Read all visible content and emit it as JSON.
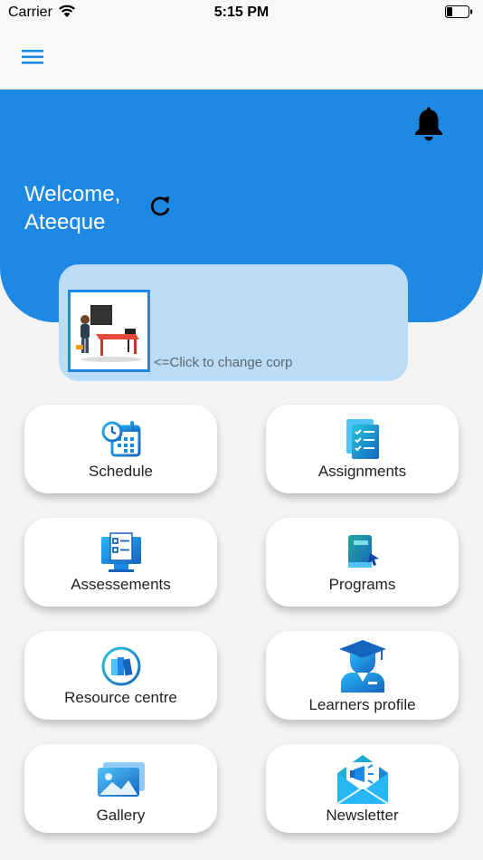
{
  "status_bar": {
    "carrier": "Carrier",
    "time": "5:15 PM"
  },
  "header": {
    "welcome_line1": "Welcome,",
    "welcome_line2": "Ateeque"
  },
  "corp": {
    "hint": "<=Click to change corp"
  },
  "tiles": [
    {
      "label": "Schedule",
      "icon": "schedule-icon"
    },
    {
      "label": "Assignments",
      "icon": "assignments-icon"
    },
    {
      "label": "Assessements",
      "icon": "assessments-icon"
    },
    {
      "label": "Programs",
      "icon": "programs-icon"
    },
    {
      "label": "Resource centre",
      "icon": "resource-centre-icon"
    },
    {
      "label": "Learners profile",
      "icon": "learners-profile-icon"
    },
    {
      "label": "Gallery",
      "icon": "gallery-icon"
    },
    {
      "label": "Newsletter",
      "icon": "newsletter-icon"
    }
  ],
  "colors": {
    "primary": "#1e88e5",
    "corp_card": "#bbdcf7",
    "background": "#f4f4f4"
  }
}
